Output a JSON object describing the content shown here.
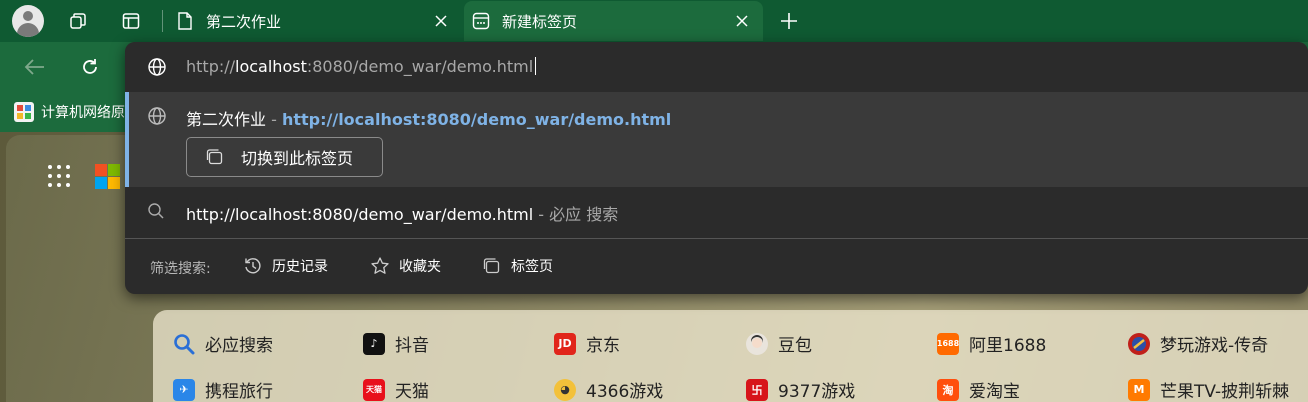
{
  "tabs": [
    {
      "title": "第二次作业",
      "active": false
    },
    {
      "title": "新建标签页",
      "active": true
    }
  ],
  "favorites": [
    {
      "label": "计算机网络原"
    }
  ],
  "omnibox": {
    "url_prefix": "http://",
    "url_host": "localhost",
    "url_rest": ":8080/demo_war/demo.html"
  },
  "suggestions": {
    "tab_match": {
      "title": "第二次作业",
      "dash": " - ",
      "url": "http://localhost:8080/demo_war/demo.html",
      "switch_label": "切换到此标签页"
    },
    "search": {
      "query": "http://localhost:8080/demo_war/demo.html",
      "suffix": " - 必应 搜索"
    }
  },
  "filter": {
    "label": "筛选搜索:",
    "chips": [
      {
        "label": "历史记录",
        "icon": "history-icon"
      },
      {
        "label": "收藏夹",
        "icon": "star-icon"
      },
      {
        "label": "标签页",
        "icon": "tabs-icon"
      }
    ]
  },
  "quick_links": {
    "row1": [
      {
        "label": "必应搜索",
        "icon": "search-icon"
      },
      {
        "label": "抖音",
        "icon": "douyin-icon"
      },
      {
        "label": "京东",
        "icon": "jd-icon"
      },
      {
        "label": "豆包",
        "icon": "doubao-icon"
      },
      {
        "label": "阿里1688",
        "icon": "ali1688-icon"
      },
      {
        "label": "梦玩游戏-传奇",
        "icon": "mengwan-icon"
      }
    ],
    "row2": [
      {
        "label": "携程旅行",
        "icon": "ctrip-icon"
      },
      {
        "label": "天猫",
        "icon": "tmall-icon"
      },
      {
        "label": "4366游戏",
        "icon": "4366-icon"
      },
      {
        "label": "9377游戏",
        "icon": "9377-icon"
      },
      {
        "label": "爱淘宝",
        "icon": "aitaobao-icon"
      },
      {
        "label": "芒果TV-披荆斩棘",
        "icon": "mangotv-icon"
      }
    ]
  },
  "colors": {
    "tabstrip": "#0f5a32",
    "toolbar": "#1c6b3d",
    "omnibox_bg": "#2b2b2b",
    "highlight_row": "#3a3a3a",
    "link_blue": "#7fb3e6"
  }
}
